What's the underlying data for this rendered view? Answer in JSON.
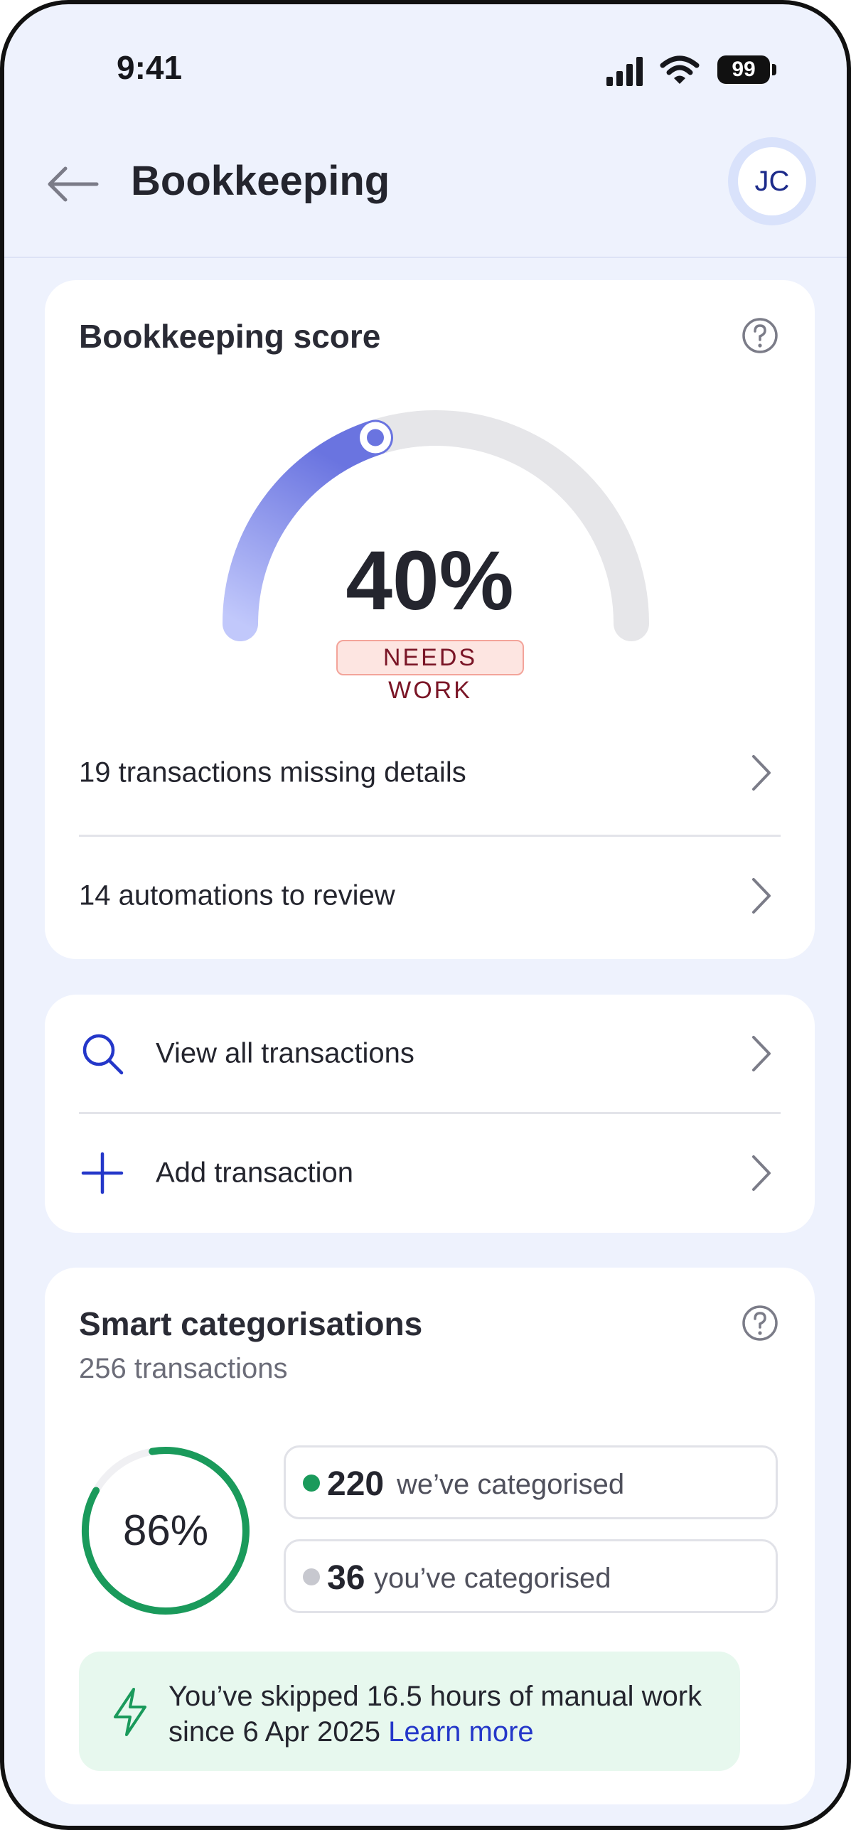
{
  "status_bar": {
    "time": "9:41",
    "battery": "99"
  },
  "header": {
    "title": "Bookkeeping",
    "avatar_initials": "JC"
  },
  "score_card": {
    "title": "Bookkeeping score",
    "score_value": 40,
    "score_text": "40%",
    "badge": "NEEDS WORK",
    "rows": [
      {
        "label": "19 transactions missing details"
      },
      {
        "label": "14 automations to review"
      }
    ]
  },
  "actions": [
    {
      "label": "View all transactions",
      "icon": "search-icon"
    },
    {
      "label": "Add transaction",
      "icon": "plus-icon"
    }
  ],
  "smart": {
    "title": "Smart categorisations",
    "subtitle": "256 transactions",
    "percent_value": 86,
    "percent_text": "86%",
    "auto_count": "220",
    "auto_label": "we’ve categorised",
    "manual_count": "36",
    "manual_label": "you’ve categorised",
    "info_text": "You’ve skipped 16.5 hours of manual work since 6 Apr 2025",
    "info_link": "Learn more"
  },
  "colors": {
    "background": "#eef2fd",
    "gauge_start": "#6a74e0",
    "gauge_end": "#c1c8fb",
    "accent_blue": "#2437c9",
    "green": "#1a9a5b",
    "badge_bg": "#fde5e1",
    "badge_text": "#7a1526"
  }
}
